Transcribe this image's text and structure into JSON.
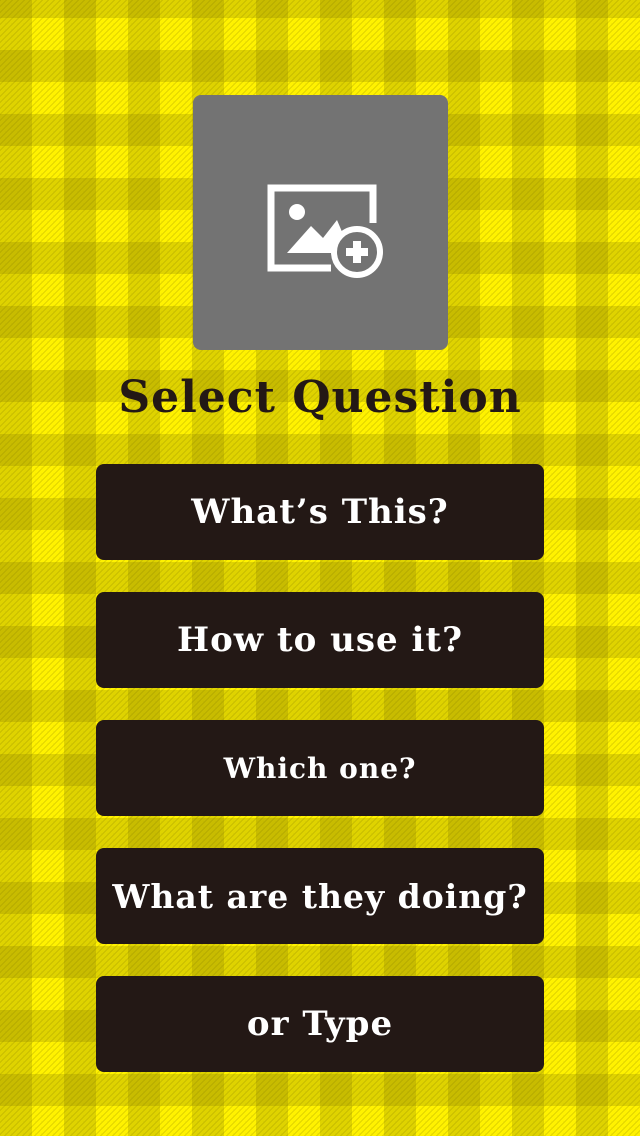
{
  "colors": {
    "background": "#fff200",
    "button_bg": "#231815",
    "button_text": "#ffffff",
    "photo_picker_bg": "#737373"
  },
  "photo_picker": {
    "icon": "add-photo-icon"
  },
  "title": "Select Question",
  "questions": [
    {
      "label": "What’s This?"
    },
    {
      "label": "How to use it?"
    },
    {
      "label": "Which one?"
    },
    {
      "label": "What are they doing?"
    },
    {
      "label": "or Type"
    }
  ]
}
